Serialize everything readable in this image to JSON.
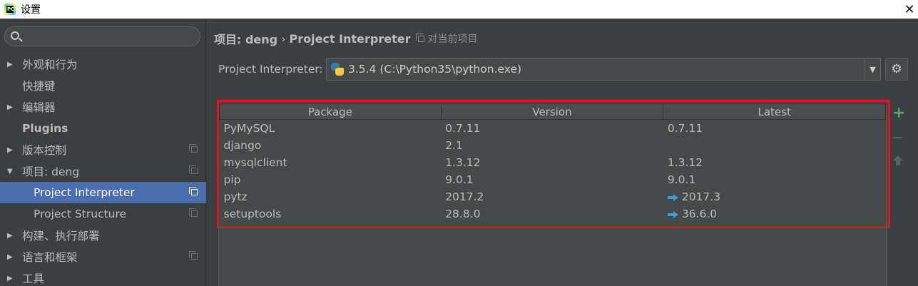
{
  "window": {
    "title": "设置",
    "close_glyph": "✕"
  },
  "sidebar": {
    "search_placeholder": "",
    "items": [
      {
        "label": "外观和行为",
        "expandable": true,
        "expanded": false
      },
      {
        "label": "快捷键",
        "expandable": false
      },
      {
        "label": "编辑器",
        "expandable": true,
        "expanded": false
      },
      {
        "label": "Plugins",
        "expandable": false
      },
      {
        "label": "版本控制",
        "expandable": true,
        "expanded": false
      },
      {
        "label": "项目: deng",
        "expandable": true,
        "expanded": true
      },
      {
        "label": "Project Interpreter",
        "selected": true
      },
      {
        "label": "Project Structure"
      },
      {
        "label": "构建、执行部署",
        "expandable": true,
        "expanded": false
      },
      {
        "label": "语言和框架",
        "expandable": true,
        "expanded": false
      },
      {
        "label": "工具",
        "expandable": true,
        "expanded": false
      }
    ]
  },
  "header": {
    "project": "项目: deng",
    "separator": "›",
    "page": "Project Interpreter",
    "scope_note": "对当前项目"
  },
  "interpreter": {
    "label": "Project Interpreter:",
    "value": "3.5.4 (C:\\Python35\\python.exe)"
  },
  "packages": {
    "columns": [
      "Package",
      "Version",
      "Latest"
    ],
    "rows": [
      {
        "package": "PyMySQL",
        "version": "0.7.11",
        "latest": "0.7.11",
        "upgrade": false
      },
      {
        "package": "django",
        "version": "2.1",
        "latest": "",
        "upgrade": false
      },
      {
        "package": "mysqlclient",
        "version": "1.3.12",
        "latest": "1.3.12",
        "upgrade": false
      },
      {
        "package": "pip",
        "version": "9.0.1",
        "latest": "9.0.1",
        "upgrade": false
      },
      {
        "package": "pytz",
        "version": "2017.2",
        "latest": "2017.3",
        "upgrade": true
      },
      {
        "package": "setuptools",
        "version": "28.8.0",
        "latest": "36.6.0",
        "upgrade": true
      }
    ]
  },
  "actions": {
    "add": "+"
  },
  "colors": {
    "selection": "#4b6eaf",
    "highlight_border": "#e0161c",
    "upgrade_arrow": "#3d9fd6",
    "add_green": "#59a869"
  }
}
